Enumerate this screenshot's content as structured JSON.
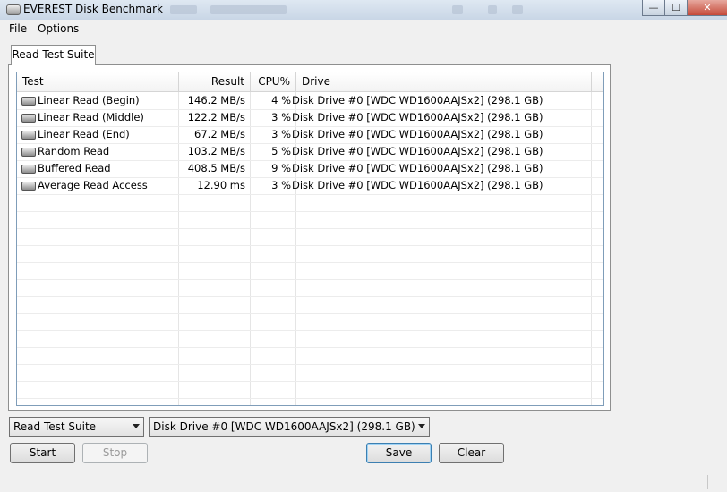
{
  "window": {
    "title": "EVEREST Disk Benchmark",
    "controls": {
      "minimize": "—",
      "maximize": "☐",
      "close": "✕"
    }
  },
  "menu": {
    "file": "File",
    "options": "Options"
  },
  "tab": {
    "label": "Read Test Suite"
  },
  "table": {
    "headers": {
      "test": "Test",
      "result": "Result",
      "cpu": "CPU%",
      "drive": "Drive"
    },
    "rows": [
      {
        "test": "Linear Read (Begin)",
        "result": "146.2 MB/s",
        "cpu": "4 %",
        "drive": "Disk Drive #0  [WDC WD1600AAJSx2]  (298.1 GB)"
      },
      {
        "test": "Linear Read (Middle)",
        "result": "122.2 MB/s",
        "cpu": "3 %",
        "drive": "Disk Drive #0  [WDC WD1600AAJSx2]  (298.1 GB)"
      },
      {
        "test": "Linear Read (End)",
        "result": "67.2 MB/s",
        "cpu": "3 %",
        "drive": "Disk Drive #0  [WDC WD1600AAJSx2]  (298.1 GB)"
      },
      {
        "test": "Random Read",
        "result": "103.2 MB/s",
        "cpu": "5 %",
        "drive": "Disk Drive #0  [WDC WD1600AAJSx2]  (298.1 GB)"
      },
      {
        "test": "Buffered Read",
        "result": "408.5 MB/s",
        "cpu": "9 %",
        "drive": "Disk Drive #0  [WDC WD1600AAJSx2]  (298.1 GB)"
      },
      {
        "test": "Average Read Access",
        "result": "12.90 ms",
        "cpu": "3 %",
        "drive": "Disk Drive #0  [WDC WD1600AAJSx2]  (298.1 GB)"
      }
    ]
  },
  "controls": {
    "suite_select": "Read Test Suite",
    "drive_select": "Disk Drive #0  [WDC WD1600AAJSx2]  (298.1 GB)",
    "start": "Start",
    "stop": "Stop",
    "save": "Save",
    "clear": "Clear"
  }
}
